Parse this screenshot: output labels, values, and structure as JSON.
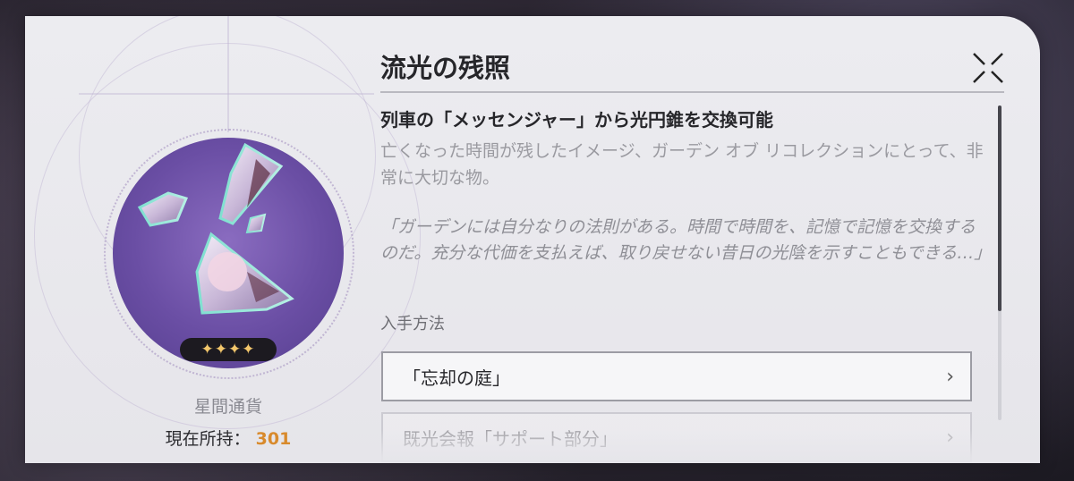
{
  "item": {
    "title": "流光の残照",
    "rarity_stars": "✦✦✦✦",
    "category": "星間通貨",
    "owned_label": "現在所持：",
    "owned_count": "301",
    "image_icon": "light-fragments-icon"
  },
  "detail": {
    "source": "列車の「メッセンジャー」から光円錐を交換可能",
    "description": "亡くなった時間が残したイメージ、ガーデン オブ リコレクションにとって、非常に大切な物。",
    "quote": "「ガーデンには自分なりの法則がある。時間で時間を、記憶で記憶を交換するのだ。充分な代価を支払えば、取り戻せない昔日の光陰を示すこともできる…」",
    "acquisition_label": "入手方法",
    "acquisition": [
      {
        "label": "「忘却の庭」"
      },
      {
        "label": "既光会報「サポート部分」"
      }
    ]
  },
  "colors": {
    "accent_orange": "#d88a2c",
    "item_bg_purple": "#6a4ea4",
    "stars_gold": "#f2c66b"
  },
  "icons": {
    "close": "close-x-icon",
    "chevron": "chevron-right-icon"
  }
}
